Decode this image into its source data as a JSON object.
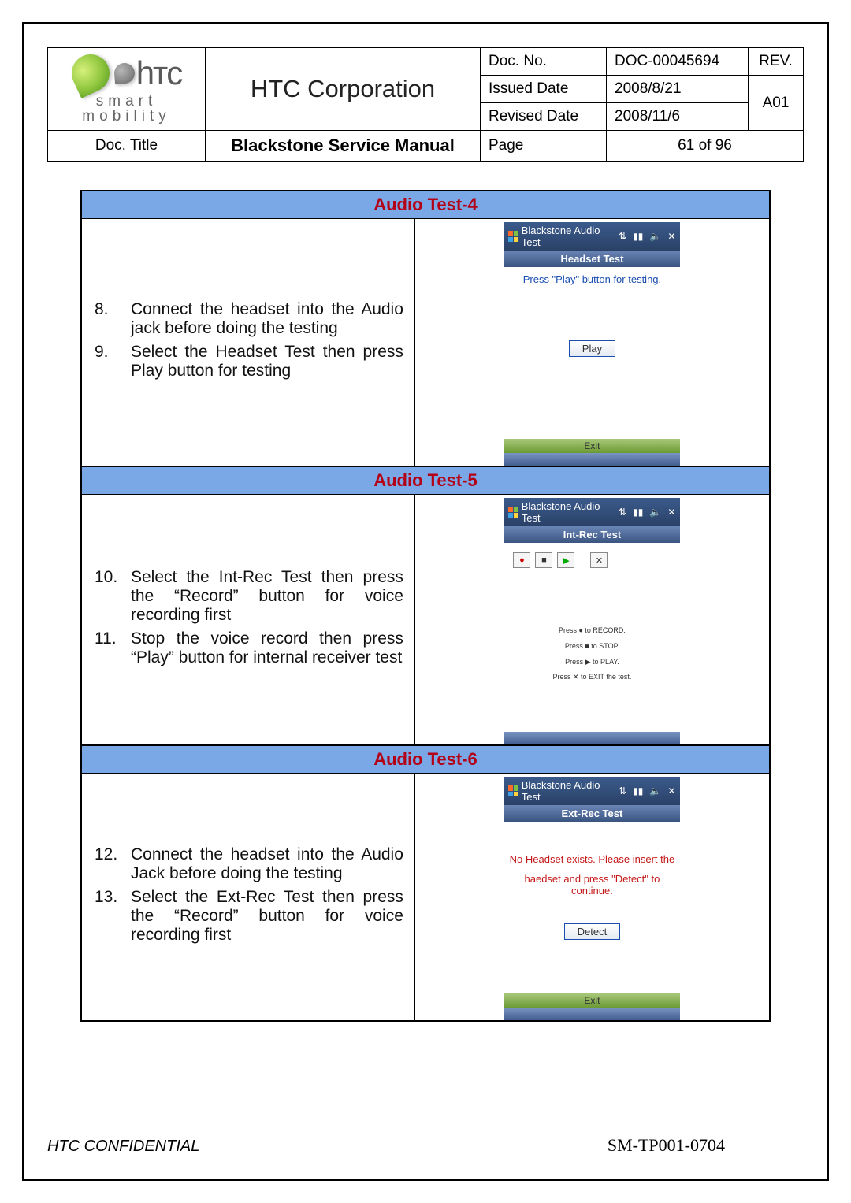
{
  "header": {
    "company": "HTC Corporation",
    "tagline": "smart mobility",
    "doc_no_label": "Doc. No.",
    "doc_no": "DOC-00045694",
    "rev_label": "REV.",
    "rev": "A01",
    "issued_label": "Issued Date",
    "issued": "2008/8/21",
    "revised_label": "Revised Date",
    "revised": "2008/11/6",
    "doctitle_label": "Doc. Title",
    "doctitle": "Blackstone Service Manual",
    "page_label": "Page",
    "page": "61  of  96"
  },
  "sections": [
    {
      "title": "Audio Test-4",
      "steps": [
        {
          "num": "8.",
          "text": "Connect the headset into the Audio jack before doing the testing"
        },
        {
          "num": "9.",
          "text": "Select the Headset Test then press Play button for testing"
        }
      ],
      "phone": {
        "app": "Blackstone Audio Test",
        "subtitle": "Headset Test",
        "msg": "Press \"Play\" button for testing.",
        "button": "Play",
        "exit": "Exit"
      }
    },
    {
      "title": "Audio Test-5",
      "steps": [
        {
          "num": "10.",
          "text": "Select the Int-Rec Test then press the “Record” button for voice recording first"
        },
        {
          "num": "11.",
          "text": "Stop the voice record then press “Play” button for internal receiver test"
        }
      ],
      "phone": {
        "app": "Blackstone Audio Test",
        "subtitle": "Int-Rec Test",
        "instr1": "Press ● to RECORD.",
        "instr2": "Press ■ to STOP.",
        "instr3": "Press ▶ to PLAY.",
        "instr4": "Press ✕ to EXIT the test."
      }
    },
    {
      "title": "Audio Test-6",
      "steps": [
        {
          "num": "12.",
          "text": "Connect the headset into the Audio Jack before doing the testing"
        },
        {
          "num": "13.",
          "text": "Select the Ext-Rec Test then press the “Record” button for voice recording first"
        }
      ],
      "phone": {
        "app": "Blackstone Audio Test",
        "subtitle": "Ext-Rec Test",
        "msg1": "No Headset exists. Please insert the",
        "msg2": "haedset and press \"Detect\" to continue.",
        "button": "Detect",
        "exit": "Exit"
      }
    }
  ],
  "footer": {
    "conf": "HTC CONFIDENTIAL",
    "code": "SM-TP001-0704"
  }
}
